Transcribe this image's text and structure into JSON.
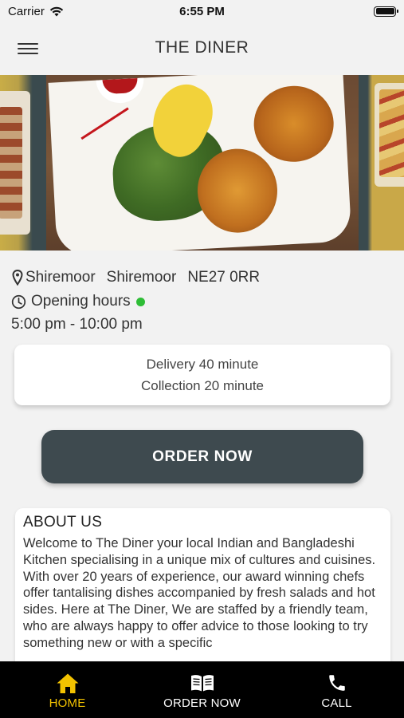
{
  "status_bar": {
    "carrier": "Carrier",
    "time": "6:55 PM"
  },
  "header": {
    "title": "THE DINER"
  },
  "info": {
    "address_parts": [
      "Shiremoor",
      "Shiremoor",
      "NE27 0RR"
    ],
    "opening_hours_label": "Opening hours",
    "opening_hours_time": "5:00 pm - 10:00 pm",
    "open_status_color": "#2ebd36"
  },
  "delivery": {
    "delivery_text": "Delivery 40 minute",
    "collection_text": "Collection 20 minute"
  },
  "order_button": {
    "label": "ORDER NOW",
    "color": "#3e4a4f"
  },
  "about": {
    "title": "ABOUT US",
    "text": "Welcome to The Diner your local Indian and Bangladeshi Kitchen specialising in a unique mix of cultures and cuisines. With over 20 years of experience, our award winning chefs offer tantalising dishes accompanied by fresh salads and hot sides. Here at The Diner, We are staffed by a friendly team, who are always happy to offer advice to those looking to try something new or with a specific"
  },
  "tab_bar": {
    "active_color": "#f2c200",
    "tabs": [
      {
        "label": "HOME",
        "icon": "home-icon",
        "active": true
      },
      {
        "label": "ORDER NOW",
        "icon": "menu-book-icon",
        "active": false
      },
      {
        "label": "CALL",
        "icon": "phone-icon",
        "active": false
      }
    ]
  }
}
